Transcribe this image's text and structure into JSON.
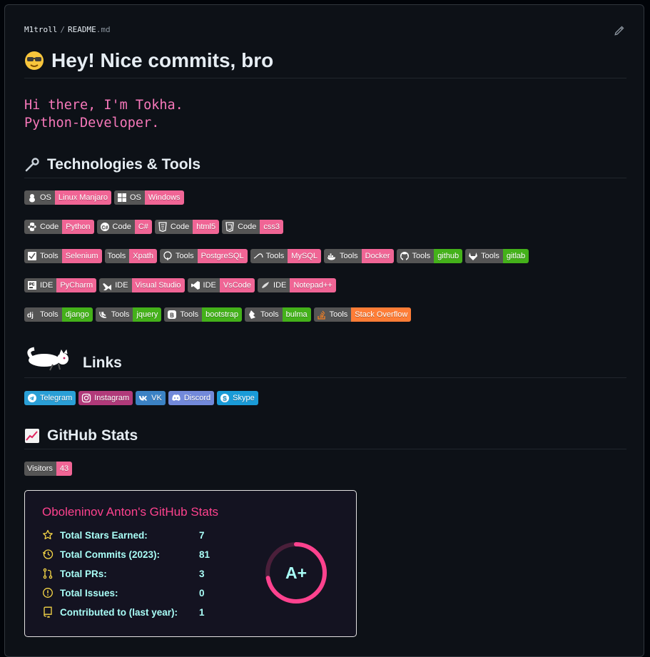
{
  "breadcrumb": {
    "user": "M1troll",
    "sep": "/",
    "file": "README",
    "ext": ".md"
  },
  "heading": "Hey! Nice commits, bro",
  "intro": {
    "line1": "Hi there, I'm Tokha.",
    "line2": "Python-Developer."
  },
  "sections": {
    "tech": "Technologies & Tools",
    "links": "Links",
    "stats": "GitHub Stats"
  },
  "badges": {
    "os": [
      {
        "label": "OS",
        "value": "Linux Manjaro",
        "icon": "linux-icon",
        "color": "#f06595"
      },
      {
        "label": "OS",
        "value": "Windows",
        "icon": "windows-icon",
        "color": "#f06595"
      }
    ],
    "code": [
      {
        "label": "Code",
        "value": "Python",
        "icon": "python-icon",
        "color": "#f06595"
      },
      {
        "label": "Code",
        "value": "C#",
        "icon": "csharp-icon",
        "color": "#f06595"
      },
      {
        "label": "Code",
        "value": "html5",
        "icon": "html5-icon",
        "color": "#f06595"
      },
      {
        "label": "Code",
        "value": "css3",
        "icon": "css3-icon",
        "color": "#f06595"
      }
    ],
    "tools1": [
      {
        "label": "Tools",
        "value": "Selenium",
        "icon": "selenium-icon",
        "color": "#f06595"
      },
      {
        "label": "Tools",
        "value": "Xpath",
        "icon": "",
        "color": "#f06595"
      },
      {
        "label": "Tools",
        "value": "PostgreSQL",
        "icon": "postgresql-icon",
        "color": "#f06595"
      },
      {
        "label": "Tools",
        "value": "MySQL",
        "icon": "mysql-icon",
        "color": "#f06595"
      },
      {
        "label": "Tools",
        "value": "Docker",
        "icon": "docker-icon",
        "color": "#f06595"
      },
      {
        "label": "Tools",
        "value": "github",
        "icon": "github-icon",
        "color": "#44b11a"
      },
      {
        "label": "Tools",
        "value": "gitlab",
        "icon": "gitlab-icon",
        "color": "#44b11a"
      }
    ],
    "ide": [
      {
        "label": "IDE",
        "value": "PyCharm",
        "icon": "pycharm-icon",
        "color": "#f06595"
      },
      {
        "label": "IDE",
        "value": "Visual Studio",
        "icon": "visualstudio-icon",
        "color": "#f06595"
      },
      {
        "label": "IDE",
        "value": "VsCode",
        "icon": "vscode-icon",
        "color": "#f06595"
      },
      {
        "label": "IDE",
        "value": "Notepad++",
        "icon": "notepadpp-icon",
        "color": "#f06595"
      }
    ],
    "tools2": [
      {
        "label": "Tools",
        "value": "django",
        "icon": "django-icon",
        "color": "#44b11a"
      },
      {
        "label": "Tools",
        "value": "jquery",
        "icon": "jquery-icon",
        "color": "#44b11a"
      },
      {
        "label": "Tools",
        "value": "bootstrap",
        "icon": "bootstrap-icon",
        "color": "#44b11a"
      },
      {
        "label": "Tools",
        "value": "bulma",
        "icon": "bulma-icon",
        "color": "#44b11a"
      },
      {
        "label": "Tools",
        "value": "Stack Overflow",
        "icon": "stackoverflow-icon",
        "color": "#fe7d37"
      }
    ],
    "links": [
      {
        "value": "Telegram",
        "icon": "telegram-icon",
        "color": "#2a9fd6"
      },
      {
        "value": "Instagram",
        "icon": "instagram-icon",
        "color": "#b13a7a"
      },
      {
        "value": "VK",
        "icon": "vk-icon",
        "color": "#3b82c4"
      },
      {
        "value": "Discord",
        "icon": "discord-icon",
        "color": "#7289da"
      },
      {
        "value": "Skype",
        "icon": "skype-icon",
        "color": "#1a9bd7"
      }
    ],
    "visitors": {
      "label": "Visitors",
      "value": "43",
      "color": "#f06595"
    }
  },
  "github_stats": {
    "title": "Oboleninov Anton's GitHub Stats",
    "rows": [
      {
        "label": "Total Stars Earned:",
        "value": "7",
        "icon": "star-icon"
      },
      {
        "label": "Total Commits (2023):",
        "value": "81",
        "icon": "history-icon"
      },
      {
        "label": "Total PRs:",
        "value": "3",
        "icon": "pull-request-icon"
      },
      {
        "label": "Total Issues:",
        "value": "0",
        "icon": "issue-icon"
      },
      {
        "label": "Contributed to (last year):",
        "value": "1",
        "icon": "repo-icon"
      }
    ],
    "grade": "A+",
    "ring_fraction": 0.72,
    "colors": {
      "title": "#fe428e",
      "text": "#a9fef7",
      "icon": "#f8d847",
      "ring": "#fe428e"
    }
  }
}
